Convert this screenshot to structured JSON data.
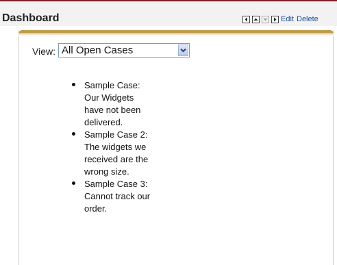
{
  "header": {
    "title": "Dashboard",
    "edit_label": "Edit",
    "delete_label": "Delete"
  },
  "view": {
    "label": "View:",
    "selected": "All Open Cases"
  },
  "cases": [
    {
      "text": "Sample Case: Our Widgets have not been delivered."
    },
    {
      "text": "Sample Case 2: The widgets we received are the wrong size."
    },
    {
      "text": "Sample Case 3: Cannot track our order."
    }
  ],
  "colors": {
    "accent_border": "#7b1f2a",
    "panel_accent": "#bf9b4b",
    "link": "#1a4e9e"
  },
  "icons": [
    "arrow-left-icon",
    "arrow-up-icon",
    "arrow-down-icon",
    "arrow-right-icon",
    "chevron-down-icon"
  ]
}
